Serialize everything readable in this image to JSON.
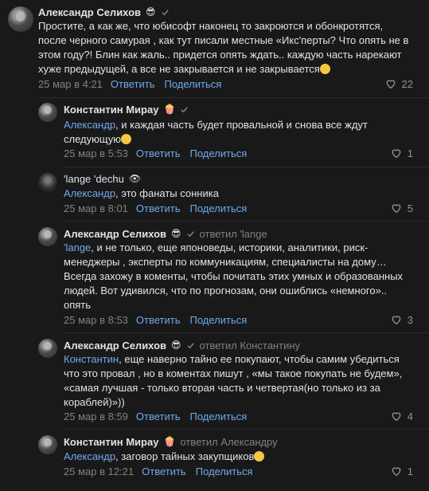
{
  "icons": {
    "verified": "check-icon",
    "like": "heart-icon",
    "mask": "sunglasses-emoji",
    "popcorn": "popcorn-emoji",
    "eye": "eye-emoji"
  },
  "colors": {
    "background": "#19191a",
    "text": "#e1e3e6",
    "link": "#71aaeb",
    "muted": "#828282"
  },
  "comments": [
    {
      "author": "Александр Селихов",
      "text": "Простите, а как же, что юбисофт наконец то закроются и обонкротятся,\nпосле черного самурая , как тут писали местные «Икс'перты? Что опять не в\nэтом году?! Блин как жаль.. придется опять ждать.. каждую часть нарекают\nхуже предыдущей, а все не закрывается и не закрывается",
      "date": "25 мар в 4:21",
      "reply_label": "Ответить",
      "share_label": "Поделиться",
      "likes": "22"
    },
    {
      "author": "Константин Мирау",
      "mention": "Александр",
      "text": ", и каждая часть будет провальной и снова все ждут\nследующую",
      "date": "25 мар в 5:53",
      "reply_label": "Ответить",
      "share_label": "Поделиться",
      "likes": "1"
    },
    {
      "author": "'lange 'dechu",
      "mention": "Александр",
      "text": ", это фанаты сонника",
      "date": "25 мар в 8:01",
      "reply_label": "Ответить",
      "share_label": "Поделиться",
      "likes": "5"
    },
    {
      "author": "Александр Селихов",
      "replied_to": "ответил 'lange",
      "mention": "'lange",
      "text": ", и не только, еще японоведы, историки, аналитики, риск-\nменеджеры , эксперты по коммуникациям, специалисты на дому…\nВсегда захожу в коменты, чтобы почитать этих умных и образованных\nлюдей. Вот удивился, что по прогнозам, они ошиблись «немного»..\nопять",
      "date": "25 мар в 8:53",
      "reply_label": "Ответить",
      "share_label": "Поделиться",
      "likes": "3"
    },
    {
      "author": "Александр Селихов",
      "replied_to": "ответил Константину",
      "mention": "Константин",
      "text": ", еще наверно тайно ее покупают, чтобы самим убедиться\nчто это провал , но в коментах пишут , «мы такое покупать не будем»,\n«самая лучшая - только вторая часть и четвертая(но только из за\nкораблей)»))",
      "date": "25 мар в 8:59",
      "reply_label": "Ответить",
      "share_label": "Поделиться",
      "likes": "4"
    },
    {
      "author": "Константин Мирау",
      "replied_to": "ответил Александру",
      "mention": "Александр",
      "text": ", заговор тайных закупщиков",
      "date": "25 мар в 12:21",
      "reply_label": "Ответить",
      "share_label": "Поделиться",
      "likes": "1"
    }
  ]
}
